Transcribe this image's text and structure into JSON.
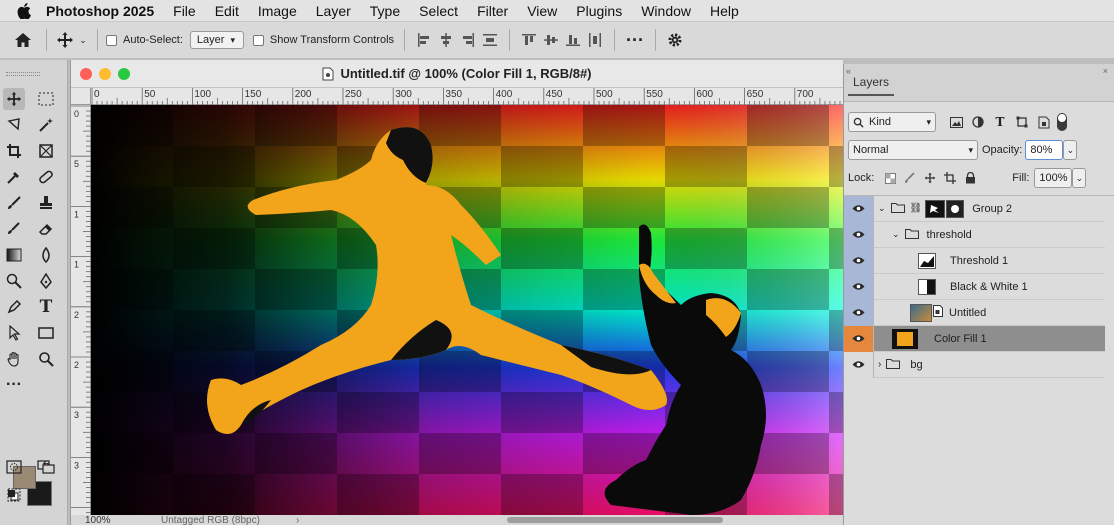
{
  "menubar": {
    "app": "Photoshop 2025",
    "items": [
      "File",
      "Edit",
      "Image",
      "Layer",
      "Type",
      "Select",
      "Filter",
      "View",
      "Plugins",
      "Window",
      "Help"
    ]
  },
  "options": {
    "auto_select_label": "Auto-Select:",
    "auto_select_value": "Layer",
    "show_transform_label": "Show Transform Controls"
  },
  "document": {
    "title": "Untitled.tif @ 100% (Color Fill 1, RGB/8#)",
    "ruler_top": [
      "0",
      "50",
      "100",
      "150",
      "200",
      "250",
      "300",
      "350",
      "400",
      "450",
      "500",
      "550",
      "600",
      "650",
      "700"
    ],
    "ruler_left": [
      "0",
      "5",
      "1",
      "1",
      "2",
      "2",
      "3",
      "3"
    ],
    "status_zoom": "100%",
    "status_profile": "Untagged RGB (8bpc)"
  },
  "colors": {
    "foreground": "#9a8a74",
    "background": "#1a1a1a",
    "accent": "#e5883d",
    "fill_orange": "#f2a51a"
  },
  "layers_panel": {
    "tab": "Layers",
    "filter_kind": "Kind",
    "blend_mode": "Normal",
    "opacity_label": "Opacity:",
    "opacity_value": "80%",
    "lock_label": "Lock:",
    "fill_label": "Fill:",
    "fill_value": "100%",
    "layers": [
      {
        "name": "Group 2"
      },
      {
        "name": "threshold"
      },
      {
        "name": "Threshold 1"
      },
      {
        "name": "Black & White 1"
      },
      {
        "name": "Untitled"
      },
      {
        "name": "Color Fill 1"
      },
      {
        "name": "bg"
      }
    ]
  }
}
